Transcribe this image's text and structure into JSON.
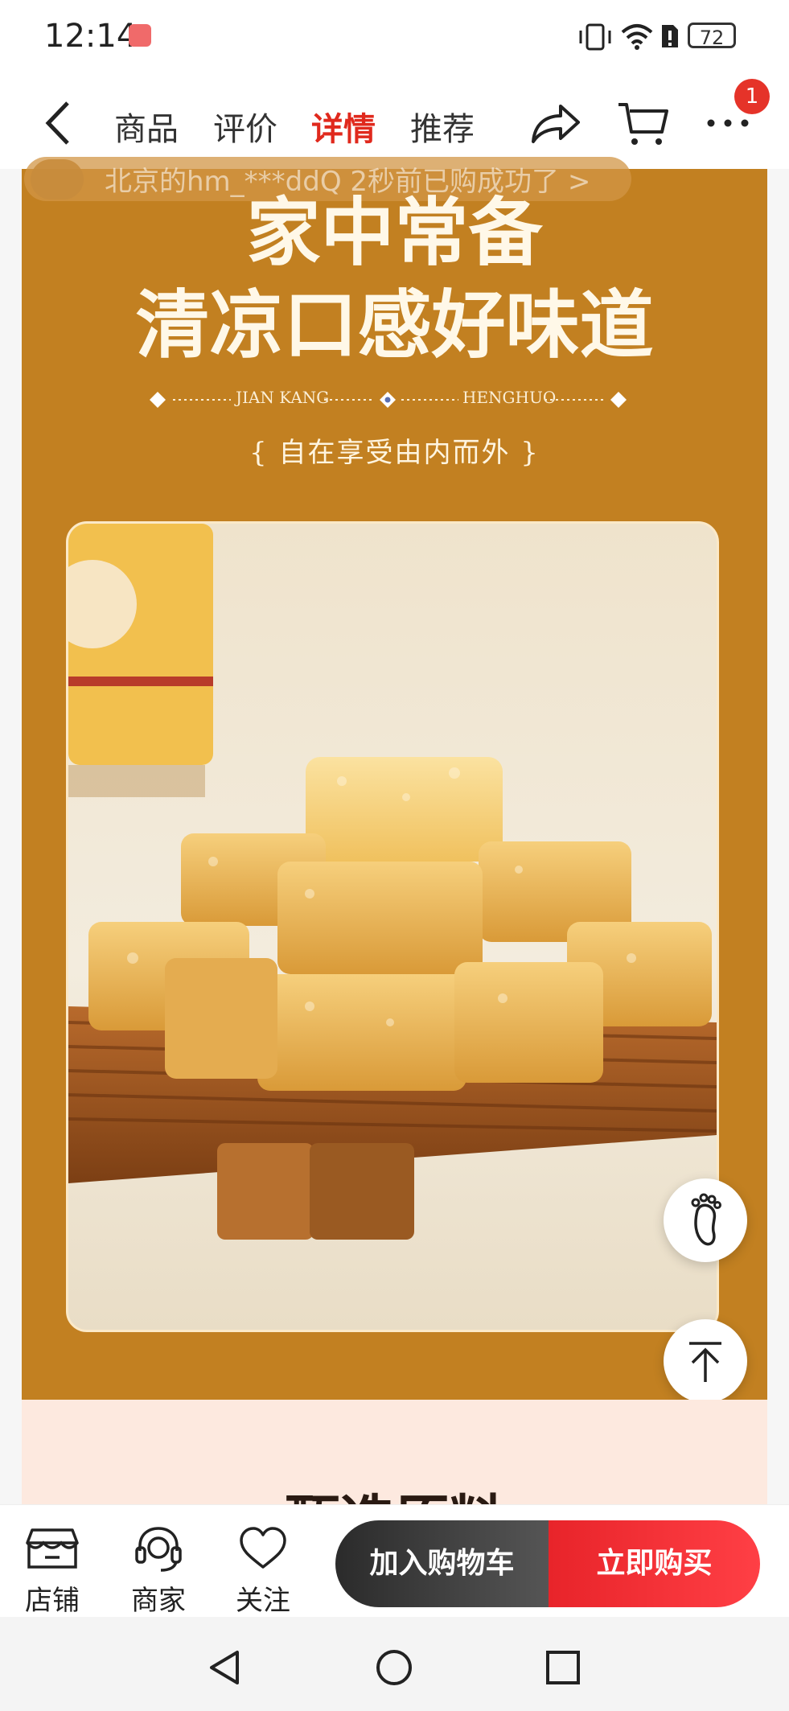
{
  "status_bar": {
    "time": "12:14",
    "battery": "72"
  },
  "nav": {
    "tabs": [
      {
        "label": "商品",
        "active": false
      },
      {
        "label": "评价",
        "active": false
      },
      {
        "label": "详情",
        "active": true
      },
      {
        "label": "推荐",
        "active": false
      }
    ],
    "more_badge": "1"
  },
  "toast": {
    "text": "北京的hm_***ddQ 2秒前已购成功了 >"
  },
  "poster": {
    "headline_1": "家中常备",
    "headline_2": "清凉口感好味道",
    "deco_left": "JIAN KANG",
    "deco_right": "HENGHUO",
    "subtitle": "{    自在享受由内而外    }"
  },
  "next_section": {
    "title": "甄选原料"
  },
  "bottom_bar": {
    "shop_label": "店铺",
    "merchant_label": "商家",
    "follow_label": "关注",
    "add_to_cart_label": "加入购物车",
    "buy_now_label": "立即购买"
  },
  "colors": {
    "accent": "#e0291d",
    "poster_bg": "#c28021",
    "buy_now": "#e8242a"
  }
}
